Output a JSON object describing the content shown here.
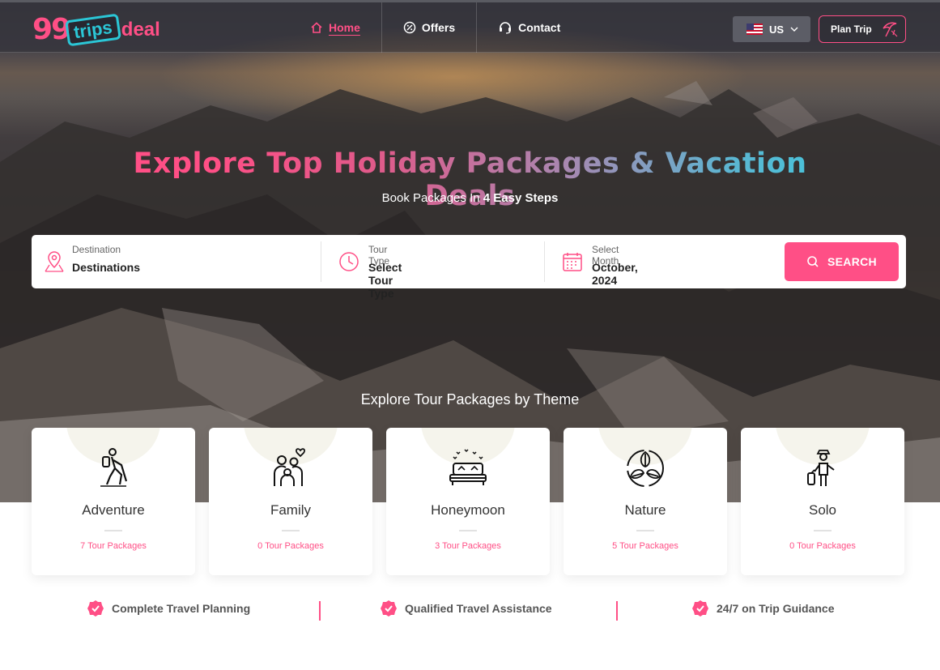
{
  "nav": {
    "logo": {
      "num": "99",
      "trips": "trips",
      "deal": "deal"
    },
    "items": [
      {
        "label": "Home",
        "icon": "home-icon"
      },
      {
        "label": "Offers",
        "icon": "percent-badge-icon"
      },
      {
        "label": "Contact",
        "icon": "headset-icon"
      }
    ],
    "lang": "US",
    "plan_trip": "Plan Trip"
  },
  "hero": {
    "headline": "Explore Top Holiday Packages & Vacation Deals",
    "sub_prefix": "Book Packages In",
    "sub_bold": "4 Easy Steps"
  },
  "search": {
    "destination_label": "Destination",
    "destination_value": "Destinations",
    "tour_type_label": "Tour Type",
    "tour_type_value": "Select Tour Type",
    "month_label": "Select Month",
    "month_value": "October, 2024",
    "button": "SEARCH"
  },
  "themes": {
    "title": "Explore Tour Packages by Theme",
    "items": [
      {
        "name": "Adventure",
        "count": "7 Tour Packages"
      },
      {
        "name": "Family",
        "count": "0 Tour Packages"
      },
      {
        "name": "Honeymoon",
        "count": "3 Tour Packages"
      },
      {
        "name": "Nature",
        "count": "5 Tour Packages"
      },
      {
        "name": "Solo",
        "count": "0 Tour Packages"
      }
    ]
  },
  "features": [
    "Complete Travel Planning",
    "Qualified Travel Assistance",
    "24/7 on Trip Guidance"
  ],
  "colors": {
    "accent": "#ff4f86",
    "teal": "#2bc6d6"
  }
}
